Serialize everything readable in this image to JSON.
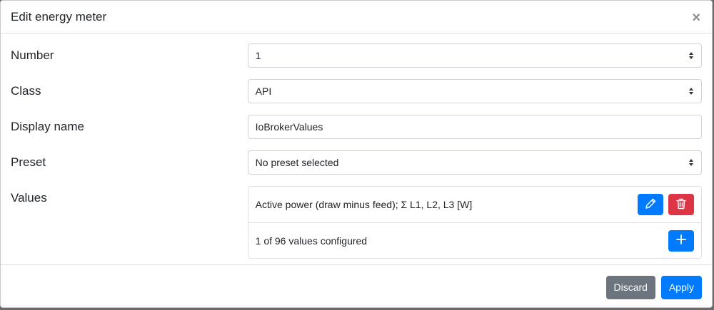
{
  "modal": {
    "title": "Edit energy meter",
    "close_glyph": "×"
  },
  "form": {
    "number": {
      "label": "Number",
      "value": "1"
    },
    "class": {
      "label": "Class",
      "value": "API"
    },
    "display_name": {
      "label": "Display name",
      "value": "IoBrokerValues"
    },
    "preset": {
      "label": "Preset",
      "value": "No preset selected"
    },
    "values": {
      "label": "Values",
      "items": [
        {
          "text": "Active power (draw minus feed); Σ L1, L2, L3 [W]"
        }
      ],
      "summary": "1 of 96 values configured"
    }
  },
  "footer": {
    "discard_label": "Discard",
    "apply_label": "Apply"
  },
  "icons": {
    "edit": "pencil-icon",
    "delete": "trash-icon",
    "add": "plus-icon",
    "select": "select-arrows-icon"
  },
  "colors": {
    "primary": "#007bff",
    "danger": "#dc3545",
    "secondary": "#6c757d"
  }
}
